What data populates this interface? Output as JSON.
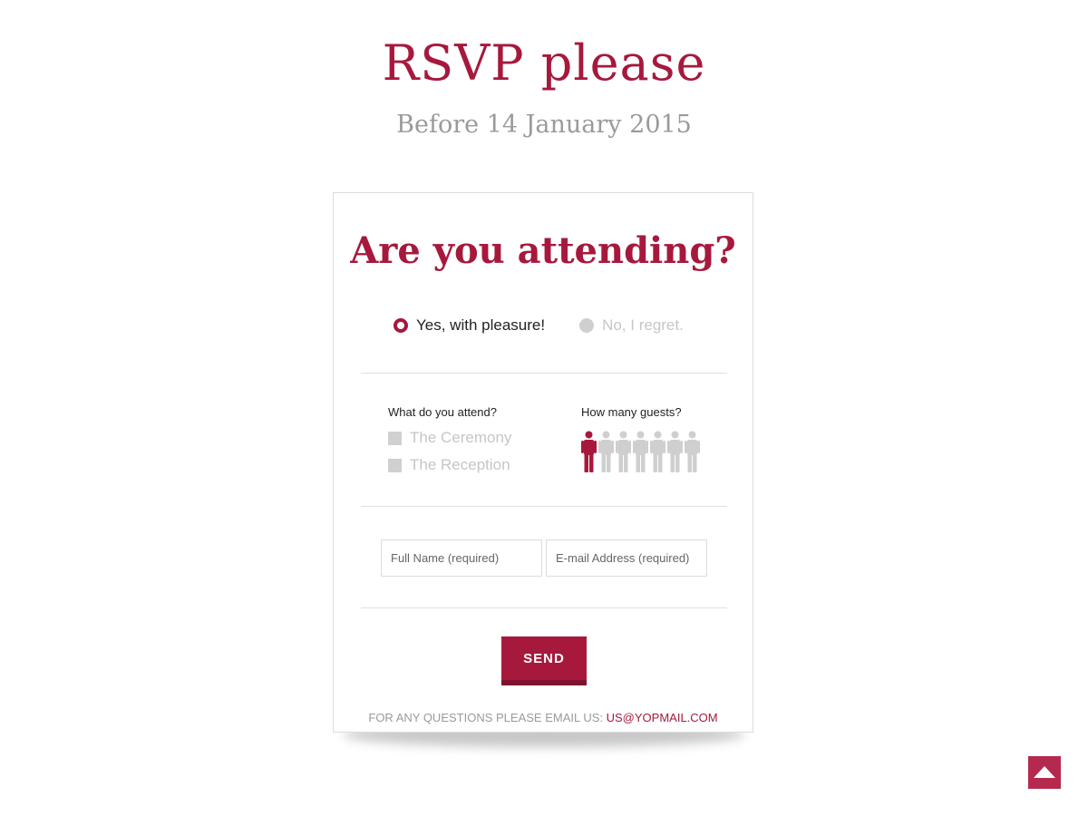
{
  "header": {
    "title": "RSVP please",
    "subtitle": "Before 14 January 2015"
  },
  "card": {
    "heading": "Are you attending?",
    "attendance": {
      "options": [
        {
          "label": "Yes, with pleasure!",
          "selected": true
        },
        {
          "label": "No, I regret.",
          "selected": false
        }
      ]
    },
    "events": {
      "label": "What do you attend?",
      "options": [
        {
          "label": "The Ceremony",
          "checked": false
        },
        {
          "label": "The Reception",
          "checked": false
        }
      ]
    },
    "guests": {
      "label": "How many guests?",
      "max": 7,
      "selected": 1
    },
    "fields": {
      "name_placeholder": "Full Name (required)",
      "email_placeholder": "E-mail Address (required)"
    },
    "send_label": "SEND",
    "footer": {
      "text": "FOR ANY QUESTIONS PLEASE EMAIL US: ",
      "email": "US@YOPMAIL.COM"
    }
  },
  "colors": {
    "accent": "#a6193d",
    "inactive": "#cfcfcf",
    "scroll_button": "#b5294e"
  },
  "icons": {
    "guest": "person-icon",
    "scroll_top": "triangle-up-icon"
  }
}
